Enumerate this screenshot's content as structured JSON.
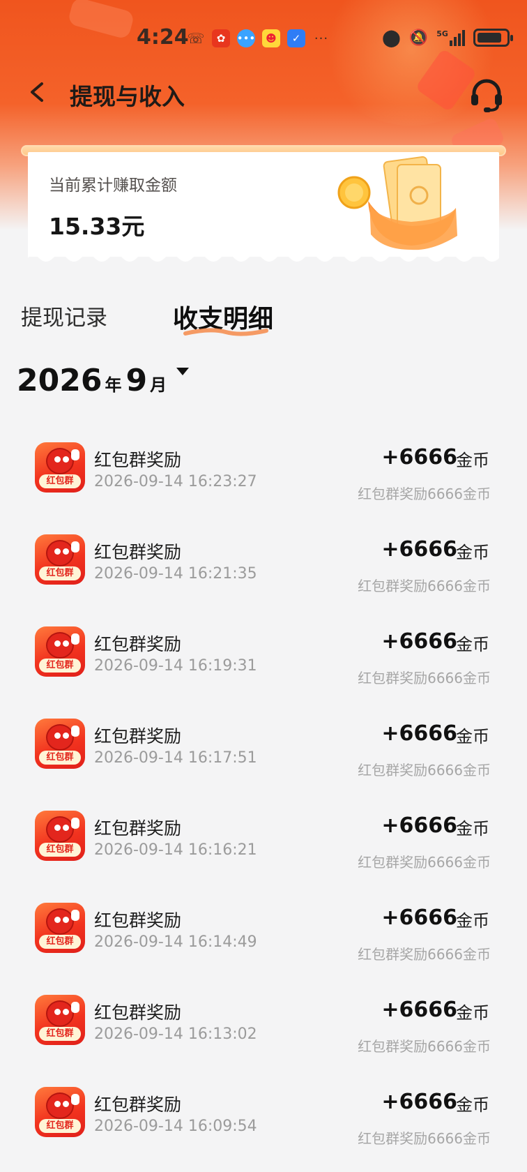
{
  "status_bar": {
    "time": "4:24",
    "network": "5G"
  },
  "nav": {
    "title": "提现与收入"
  },
  "earnings": {
    "label": "当前累计赚取金额",
    "value": "15.33元"
  },
  "tabs": [
    {
      "label": "提现记录",
      "active": false
    },
    {
      "label": "收支明细",
      "active": true
    }
  ],
  "month_selector": {
    "year": "2026",
    "year_unit": "年",
    "month": "9",
    "month_unit": "月"
  },
  "records": [
    {
      "icon_tag": "红包群",
      "title": "红包群奖励",
      "time": "2026-09-14 16:23:27",
      "amount": "+6666",
      "unit": "金币",
      "desc": "红包群奖励6666金币"
    },
    {
      "icon_tag": "红包群",
      "title": "红包群奖励",
      "time": "2026-09-14 16:21:35",
      "amount": "+6666",
      "unit": "金币",
      "desc": "红包群奖励6666金币"
    },
    {
      "icon_tag": "红包群",
      "title": "红包群奖励",
      "time": "2026-09-14 16:19:31",
      "amount": "+6666",
      "unit": "金币",
      "desc": "红包群奖励6666金币"
    },
    {
      "icon_tag": "红包群",
      "title": "红包群奖励",
      "time": "2026-09-14 16:17:51",
      "amount": "+6666",
      "unit": "金币",
      "desc": "红包群奖励6666金币"
    },
    {
      "icon_tag": "红包群",
      "title": "红包群奖励",
      "time": "2026-09-14 16:16:21",
      "amount": "+6666",
      "unit": "金币",
      "desc": "红包群奖励6666金币"
    },
    {
      "icon_tag": "红包群",
      "title": "红包群奖励",
      "time": "2026-09-14 16:14:49",
      "amount": "+6666",
      "unit": "金币",
      "desc": "红包群奖励6666金币"
    },
    {
      "icon_tag": "红包群",
      "title": "红包群奖励",
      "time": "2026-09-14 16:13:02",
      "amount": "+6666",
      "unit": "金币",
      "desc": "红包群奖励6666金币"
    },
    {
      "icon_tag": "红包群",
      "title": "红包群奖励",
      "time": "2026-09-14 16:09:54",
      "amount": "+6666",
      "unit": "金币",
      "desc": "红包群奖励6666金币"
    }
  ],
  "colors": {
    "header_orange": "#f0551e",
    "background": "#f4f4f5",
    "tab_underline": "#f58a4a",
    "icon_red": "#e3261d"
  }
}
